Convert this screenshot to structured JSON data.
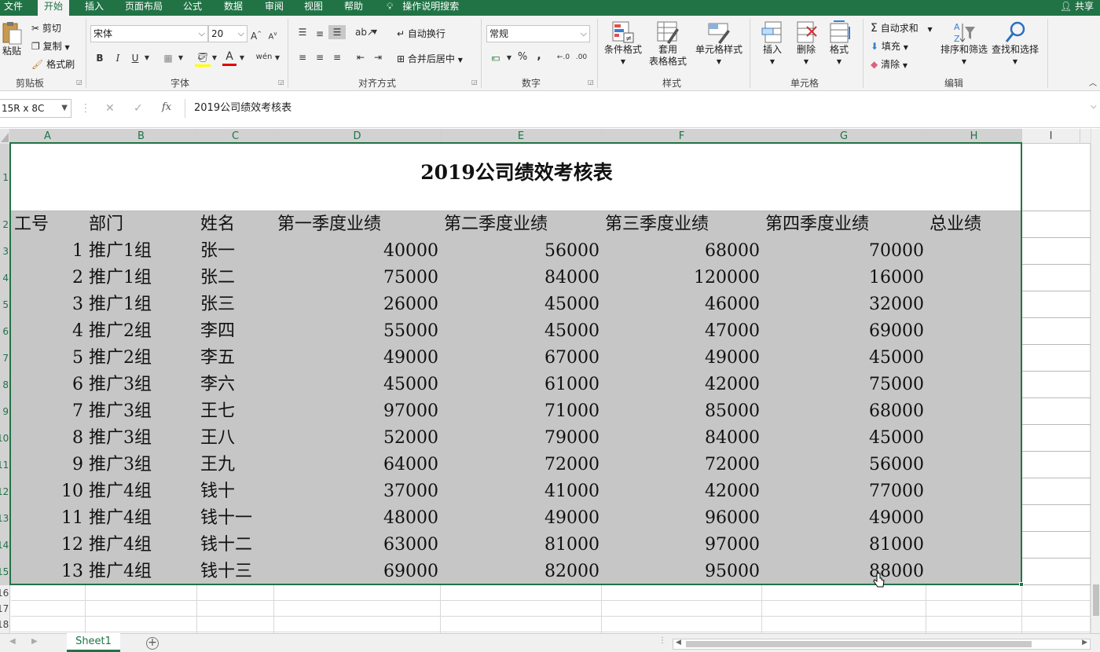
{
  "tabs": [
    "文件",
    "开始",
    "插入",
    "页面布局",
    "公式",
    "数据",
    "审阅",
    "视图",
    "帮助"
  ],
  "tell_me": "操作说明搜索",
  "share": "共享",
  "clipboard": {
    "paste": "粘贴",
    "cut": "剪切",
    "copy": "复制",
    "format_painter": "格式刷",
    "label": "剪贴板"
  },
  "font": {
    "name": "宋体",
    "size": "20",
    "label": "字体",
    "bold": "B",
    "italic": "I",
    "underline": "U"
  },
  "alignment": {
    "wrap": "自动换行",
    "merge": "合并后居中",
    "label": "对齐方式"
  },
  "number": {
    "format": "常规",
    "label": "数字",
    "percent": "%",
    "comma": ","
  },
  "styles": {
    "conditional": "条件格式",
    "table_line1": "套用",
    "table_line2": "表格格式",
    "cell_styles": "单元格样式",
    "label": "样式"
  },
  "cells_group": {
    "insert": "插入",
    "delete": "删除",
    "format": "格式",
    "label": "单元格"
  },
  "editing": {
    "autosum": "自动求和",
    "fill": "填充",
    "clear": "清除",
    "sort": "排序和筛选",
    "find": "查找和选择",
    "label": "编辑"
  },
  "namebox": "15R x 8C",
  "formula": "2019公司绩效考核表",
  "columns": [
    "A",
    "B",
    "C",
    "D",
    "E",
    "F",
    "G",
    "H",
    "I"
  ],
  "sheet_title": "2019公司绩效考核表",
  "headers": [
    "工号",
    "部门",
    "姓名",
    "第一季度业绩",
    "第二季度业绩",
    "第三季度业绩",
    "第四季度业绩",
    "总业绩"
  ],
  "rows": [
    [
      "1",
      "推广1组",
      "张一",
      "40000",
      "56000",
      "68000",
      "70000"
    ],
    [
      "2",
      "推广1组",
      "张二",
      "75000",
      "84000",
      "120000",
      "16000"
    ],
    [
      "3",
      "推广1组",
      "张三",
      "26000",
      "45000",
      "46000",
      "32000"
    ],
    [
      "4",
      "推广2组",
      "李四",
      "55000",
      "45000",
      "47000",
      "69000"
    ],
    [
      "5",
      "推广2组",
      "李五",
      "49000",
      "67000",
      "49000",
      "45000"
    ],
    [
      "6",
      "推广3组",
      "李六",
      "45000",
      "61000",
      "42000",
      "75000"
    ],
    [
      "7",
      "推广3组",
      "王七",
      "97000",
      "71000",
      "85000",
      "68000"
    ],
    [
      "8",
      "推广3组",
      "王八",
      "52000",
      "79000",
      "84000",
      "45000"
    ],
    [
      "9",
      "推广3组",
      "王九",
      "64000",
      "72000",
      "72000",
      "56000"
    ],
    [
      "10",
      "推广4组",
      "钱十",
      "37000",
      "41000",
      "42000",
      "77000"
    ],
    [
      "11",
      "推广4组",
      "钱十一",
      "48000",
      "49000",
      "96000",
      "49000"
    ],
    [
      "12",
      "推广4组",
      "钱十二",
      "63000",
      "81000",
      "97000",
      "81000"
    ],
    [
      "13",
      "推广4组",
      "钱十三",
      "69000",
      "82000",
      "95000",
      "88000"
    ]
  ],
  "row_numbers": [
    "1",
    "2",
    "3",
    "4",
    "5",
    "6",
    "7",
    "8",
    "9",
    "10",
    "11",
    "12",
    "13",
    "14",
    "15",
    "16",
    "17",
    "18"
  ],
  "sheet_name": "Sheet1",
  "colors": {
    "accent": "#217346",
    "selection_fill": "#c6c6c6"
  }
}
